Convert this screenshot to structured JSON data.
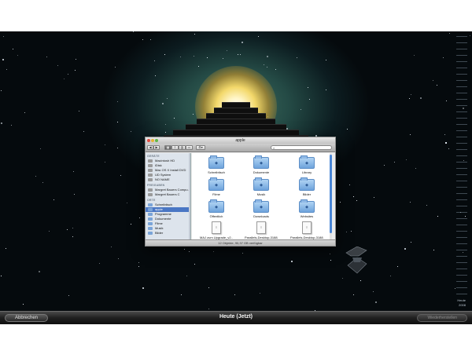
{
  "window": {
    "title": "apple",
    "status": "12 Objekte, 90,37 GB verfügbar"
  },
  "toolbar": {
    "back_icon": "back-arrow",
    "forward_icon": "forward-arrow",
    "view_icons": [
      "icon-view",
      "list-view",
      "column-view",
      "coverflow-view"
    ],
    "action_icon": "gear-icon",
    "search_placeholder": ""
  },
  "sidebar": {
    "sections": [
      {
        "title": "GERÄTE",
        "items": [
          {
            "label": "Macintosh HD",
            "selected": false
          },
          {
            "label": "iDisk",
            "selected": false
          },
          {
            "label": "Mac OS X Install DVD",
            "selected": false
          },
          {
            "label": "UD System",
            "selected": false
          },
          {
            "label": "NO NAME",
            "selected": false
          }
        ]
      },
      {
        "title": "FREIGABEN",
        "items": [
          {
            "label": "Margret Bauers Compu...",
            "selected": false
          },
          {
            "label": "Margret Bauers C",
            "selected": false
          }
        ]
      },
      {
        "title": "ORTE",
        "items": [
          {
            "label": "Schreibtisch",
            "selected": false
          },
          {
            "label": "apple",
            "selected": true
          },
          {
            "label": "Programme",
            "selected": false
          },
          {
            "label": "Dokumente",
            "selected": false
          },
          {
            "label": "Filme",
            "selected": false
          },
          {
            "label": "Musik",
            "selected": false
          },
          {
            "label": "Bilder",
            "selected": false
          }
        ]
      }
    ]
  },
  "files": [
    {
      "name": "Schreibtisch",
      "kind": "folder"
    },
    {
      "name": "Dokumente",
      "kind": "folder"
    },
    {
      "name": "Library",
      "kind": "folder"
    },
    {
      "name": "Filme",
      "kind": "folder"
    },
    {
      "name": "Musik",
      "kind": "folder"
    },
    {
      "name": "Bilder",
      "kind": "folder"
    },
    {
      "name": "Öffentlich",
      "kind": "folder"
    },
    {
      "name": "Downloads",
      "kind": "folder"
    },
    {
      "name": "Websites",
      "kind": "folder"
    },
    {
      "name": "MAJ zum Upgrade_v2...",
      "kind": "document"
    },
    {
      "name": "Parallels-Desktop-3188-...",
      "kind": "document"
    },
    {
      "name": "Parallels-Desktop-3188-...",
      "kind": "document"
    }
  ],
  "timemachine": {
    "title": "Heute (Jetzt)",
    "cancel_label": "Abbrechen",
    "restore_label": "Wiederherstellen",
    "timeline_label": "Heute",
    "timeline_year": "2008"
  },
  "colors": {
    "selection": "#4a77c4",
    "folder": "#6ea3dc",
    "sky": "#0c1c20"
  }
}
